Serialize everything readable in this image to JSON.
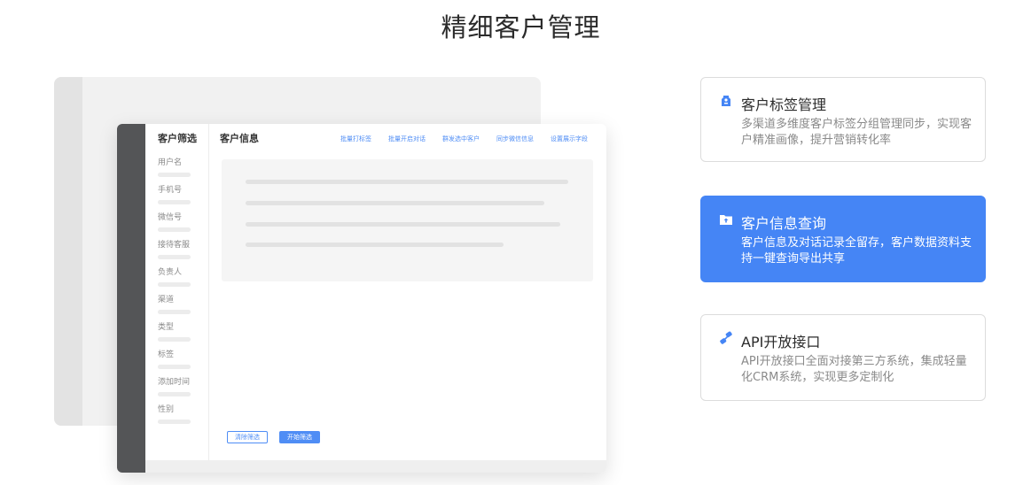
{
  "section_title": "精细客户管理",
  "mockup": {
    "filter_title": "客户筛选",
    "filters": [
      {
        "label": "用户名"
      },
      {
        "label": "手机号"
      },
      {
        "label": "微信号"
      },
      {
        "label": "接待客服"
      },
      {
        "label": "负责人"
      },
      {
        "label": "渠道"
      },
      {
        "label": "类型"
      },
      {
        "label": "标签"
      },
      {
        "label": "添加时间"
      },
      {
        "label": "性别"
      }
    ],
    "info_title": "客户信息",
    "actions": [
      "批量打标签",
      "批量开启对话",
      "群发选中客户",
      "同步微信信息",
      "设置展示字段"
    ],
    "clear_button": "清除筛选",
    "start_button": "开始筛选"
  },
  "cards": [
    {
      "icon": "tag-icon",
      "title": "客户标签管理",
      "desc": "多渠道多维度客户标签分组管理同步，实现客户精准画像，提升营销转化率",
      "active": false
    },
    {
      "icon": "folder-upload-icon",
      "title": "客户信息查询",
      "desc": "客户信息及对话记录全留存，客户数据资料支持一键查询导出共享",
      "active": true
    },
    {
      "icon": "link-icon",
      "title": "API开放接口",
      "desc": "API开放接口全面对接第三方系统，集成轻量化CRM系统，实现更多定制化",
      "active": false
    }
  ],
  "colors": {
    "accent": "#4585f5",
    "link": "#4f8df5",
    "sidebar": "#545557"
  }
}
